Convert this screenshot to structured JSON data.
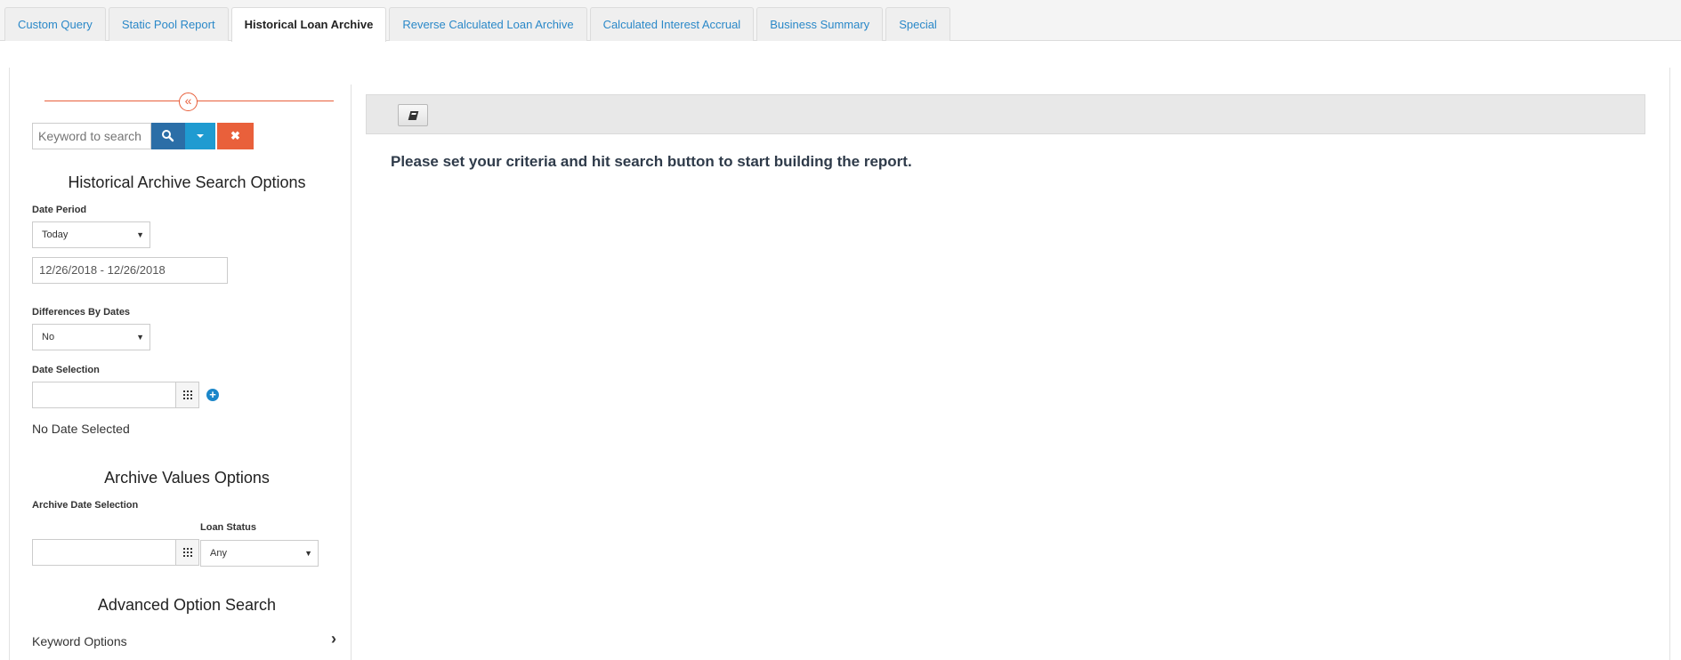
{
  "tabs": [
    {
      "label": "Custom Query",
      "active": false
    },
    {
      "label": "Static Pool Report",
      "active": false
    },
    {
      "label": "Historical Loan Archive",
      "active": true
    },
    {
      "label": "Reverse Calculated Loan Archive",
      "active": false
    },
    {
      "label": "Calculated Interest Accrual",
      "active": false
    },
    {
      "label": "Business Summary",
      "active": false
    },
    {
      "label": "Special",
      "active": false
    }
  ],
  "sidebar": {
    "collapse_icon": "double-chevron-left-icon",
    "search": {
      "placeholder": "Keyword to search",
      "value": ""
    },
    "search_icons": {
      "search": "search-icon",
      "dropdown": "caret-down-icon",
      "clear": "close-icon",
      "clear_glyph": "✖"
    },
    "historical_title": "Historical Archive Search Options",
    "date_period_label": "Date Period",
    "date_period_value": "Today",
    "date_range_value": "12/26/2018 - 12/26/2018",
    "differences_label": "Differences By Dates",
    "differences_value": "No",
    "date_selection_label": "Date Selection",
    "date_selection_value": "",
    "add_glyph": "+",
    "no_date_text": "No Date Selected",
    "archive_values_title": "Archive Values Options",
    "archive_date_label": "Archive Date Selection",
    "archive_date_value": "",
    "loan_status_label": "Loan Status",
    "loan_status_value": "Any",
    "advanced_title": "Advanced Option Search",
    "keyword_options_label": "Keyword Options",
    "keyword_options_chevron": "›"
  },
  "main": {
    "toolbar_icon": "book-icon",
    "message": "Please set your criteria and hit search button to start building the report."
  },
  "colors": {
    "tab_link": "#2a88c8",
    "accent_orange": "#e9603b",
    "search_blue": "#2b6ea7",
    "dropdown_blue": "#1f9bd1"
  }
}
